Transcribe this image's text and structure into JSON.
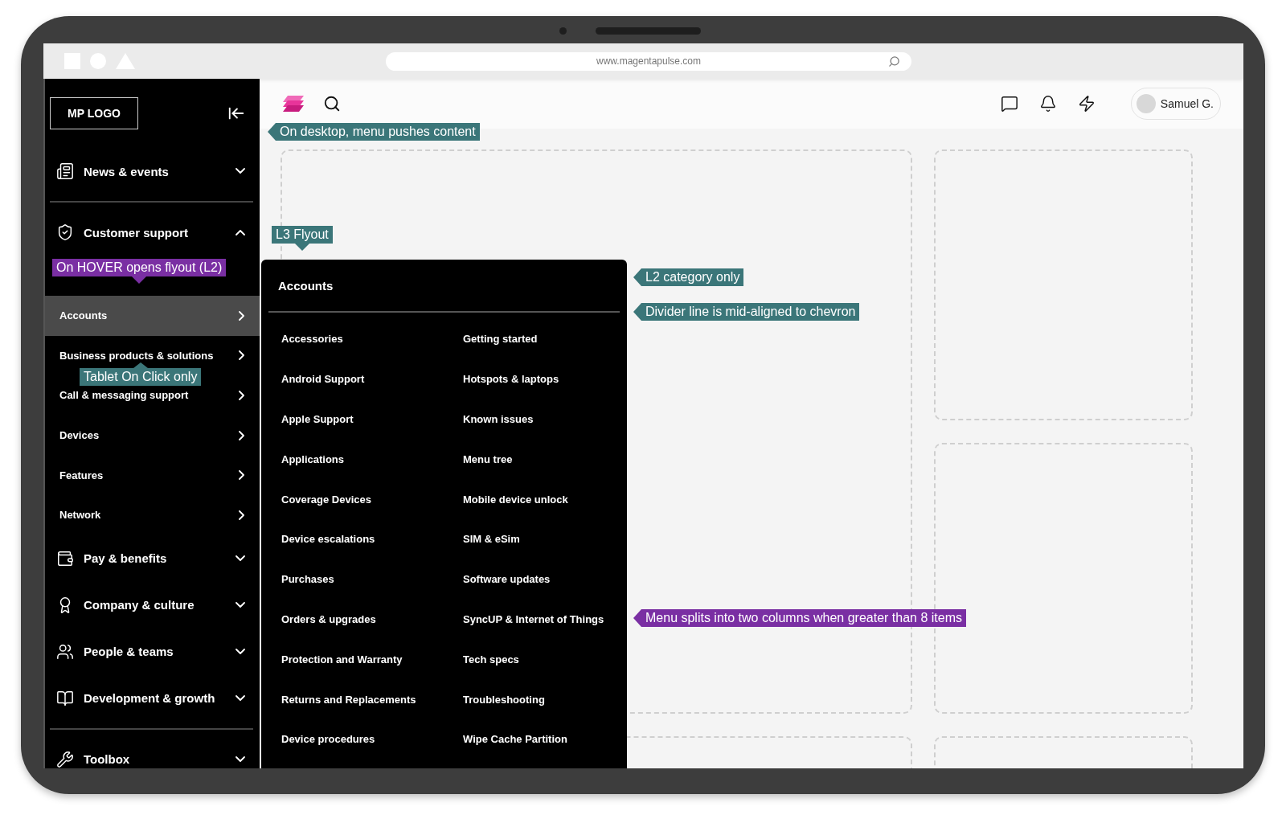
{
  "browser": {
    "url": "www.magentapulse.com"
  },
  "sidebar": {
    "logo": "MP LOGO",
    "groups": [
      {
        "sections": [
          {
            "label": "News & events",
            "expanded": false
          }
        ]
      },
      {
        "sections": [
          {
            "label": "Customer support",
            "expanded": true,
            "children": [
              {
                "label": "Accounts",
                "selected": true
              },
              {
                "label": "Business products & solutions",
                "selected": false
              },
              {
                "label": "Call & messaging support",
                "selected": false
              },
              {
                "label": "Devices",
                "selected": false
              },
              {
                "label": "Features",
                "selected": false
              },
              {
                "label": "Network",
                "selected": false
              }
            ]
          },
          {
            "label": "Pay & benefits",
            "expanded": false
          },
          {
            "label": "Company & culture",
            "expanded": false
          },
          {
            "label": "People & teams",
            "expanded": false
          },
          {
            "label": "Development & growth",
            "expanded": false
          }
        ]
      },
      {
        "sections": [
          {
            "label": "Toolbox",
            "expanded": false
          }
        ]
      }
    ]
  },
  "header": {
    "user": "Samuel G."
  },
  "flyout": {
    "title": "Accounts",
    "items": [
      "Accessories",
      "Android Support",
      "Apple Support",
      "Applications",
      "Coverage Devices",
      "Device escalations",
      "Purchases",
      "Orders & upgrades",
      "Protection and Warranty",
      "Returns and Replacements",
      "Device procedures",
      "Getting started",
      "Hotspots & laptops",
      "Known issues",
      "Menu tree",
      "Mobile device unlock",
      "SIM & eSim",
      "Software updates",
      "SyncUP & Internet of Things",
      "Tech specs",
      "Troubleshooting",
      "Wipe Cache Partition"
    ]
  },
  "annotations": [
    {
      "text": "On desktop, menu pushes content",
      "kind": "left",
      "color": "#3b7679"
    },
    {
      "text": "On HOVER opens flyout (L2)",
      "kind": "down",
      "color": "#7a2fa3"
    },
    {
      "text": "Tablet On Click only",
      "kind": "up",
      "color": "#3b7679"
    },
    {
      "text": "L3 Flyout",
      "kind": "down",
      "color": "#3b7679"
    },
    {
      "text": "L2 category only",
      "kind": "left",
      "color": "#3b7679"
    },
    {
      "text": "Divider line is mid-aligned to chevron",
      "kind": "left",
      "color": "#3b7679"
    },
    {
      "text": "Menu splits into two columns when greater than 8 items",
      "kind": "left",
      "color": "#7a2fa3"
    }
  ]
}
